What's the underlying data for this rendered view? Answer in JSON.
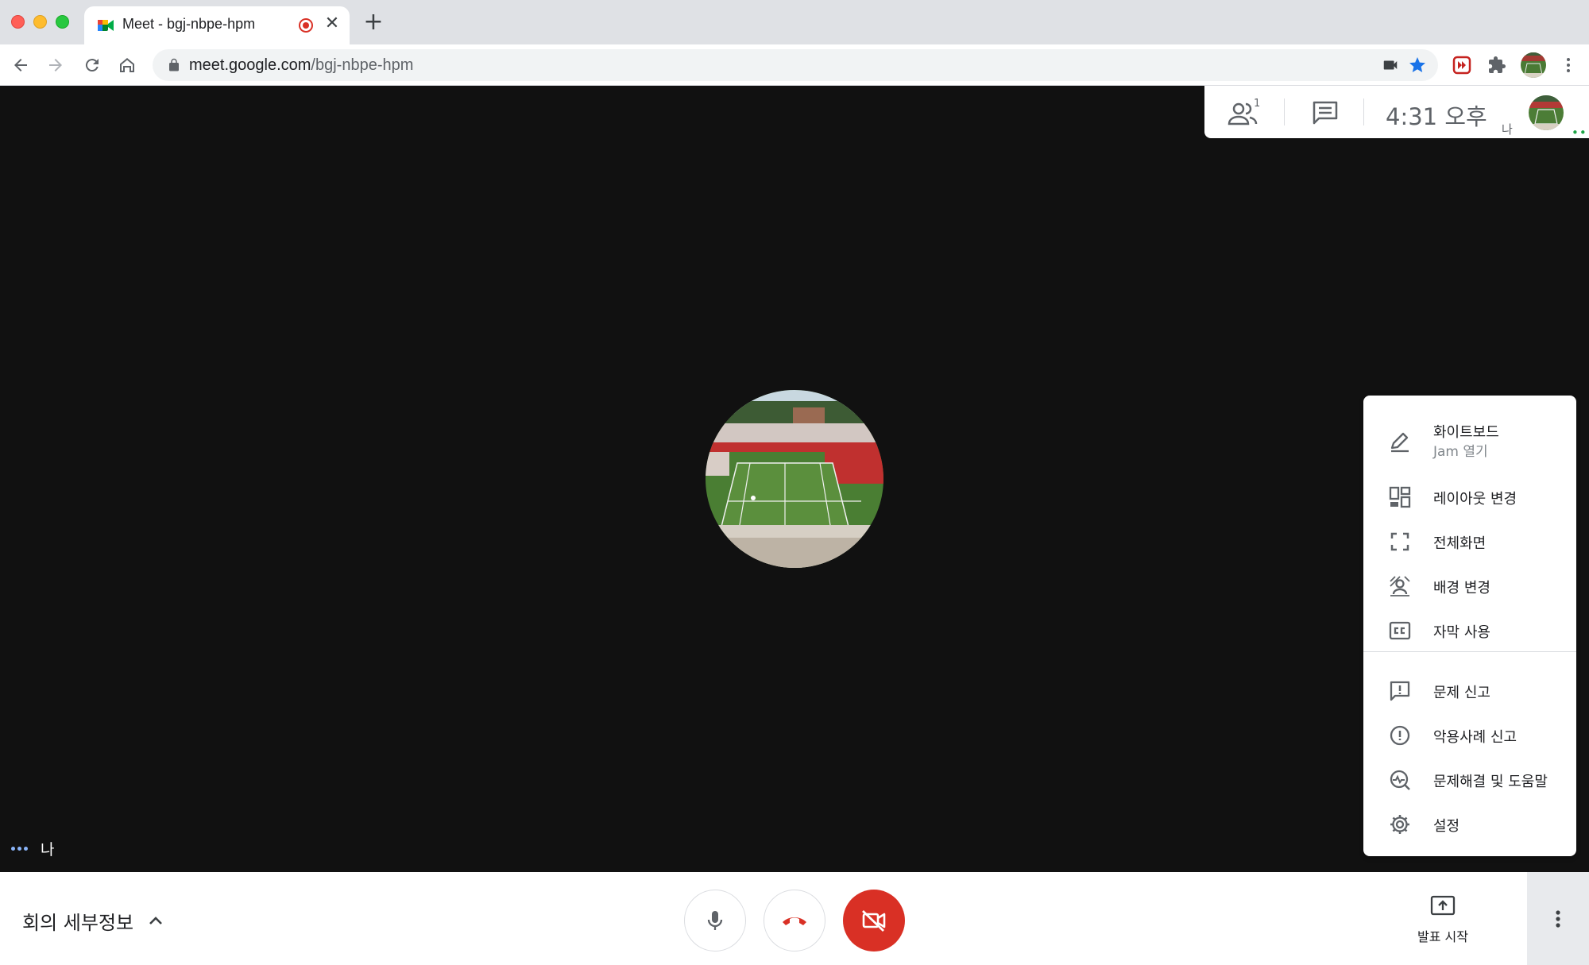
{
  "browser": {
    "tab_title": "Meet - bgj-nbpe-hpm",
    "tab_close": "✕",
    "new_tab": "+",
    "url_host": "meet.google.com",
    "url_path": "/bgj-nbpe-hpm"
  },
  "meet": {
    "topbar": {
      "participants_count": "1",
      "time": "4:31 오후",
      "self_label": "나"
    },
    "self_tile_label": "나",
    "menu": {
      "items": [
        {
          "label": "화이트보드",
          "sublabel": "Jam 열기",
          "icon": "pencil-icon"
        },
        {
          "label": "레이아웃 변경",
          "icon": "layout-icon"
        },
        {
          "label": "전체화면",
          "icon": "fullscreen-icon"
        },
        {
          "label": "배경 변경",
          "icon": "background-icon"
        },
        {
          "label": "자막 사용",
          "icon": "captions-icon"
        },
        {
          "label": "문제 신고",
          "icon": "feedback-icon"
        },
        {
          "label": "악용사례 신고",
          "icon": "report-abuse-icon"
        },
        {
          "label": "문제해결 및 도움말",
          "icon": "troubleshoot-icon"
        },
        {
          "label": "설정",
          "icon": "settings-icon"
        }
      ]
    },
    "bottombar": {
      "details_label": "회의 세부정보",
      "present_label": "발표 시작"
    }
  },
  "colors": {
    "stage": "#111111",
    "end_call_red": "#d93025",
    "accent_blue": "#1a73e8"
  }
}
